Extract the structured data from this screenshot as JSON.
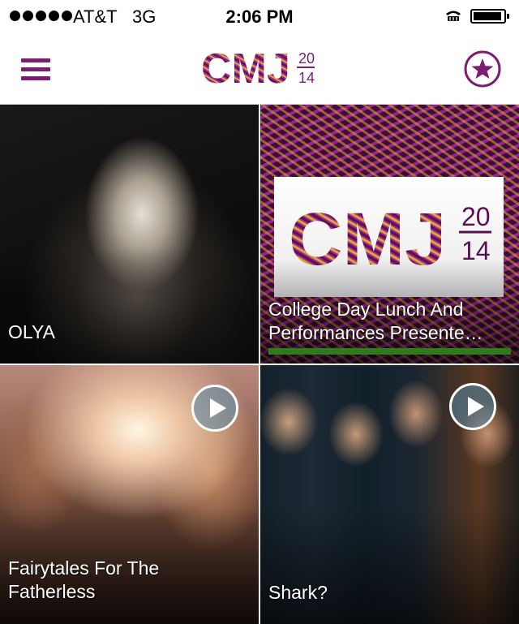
{
  "status_bar": {
    "carrier": "AT&T",
    "network": "3G",
    "time": "2:06 PM",
    "signal_bars": 5,
    "battery_level": 0.85
  },
  "nav": {
    "menu_icon": "hamburger-menu-icon",
    "logo": {
      "letters": "CMJ",
      "year_top": "20",
      "year_bottom": "14"
    },
    "favorites_icon": "star-circle-icon",
    "accent_color": "#7b1d74"
  },
  "tiles": [
    {
      "title_lines": [
        "OLYA"
      ],
      "has_play": false
    },
    {
      "title_lines": [
        "College Day Lunch And",
        "Performances Presente…"
      ],
      "has_play": false,
      "progress": 1.0,
      "progress_color": "#2f7a1d",
      "card_logo": {
        "letters": "CMJ",
        "year_top": "20",
        "year_bottom": "14"
      }
    },
    {
      "title_lines": [
        "Fairytales For The",
        "Fatherless"
      ],
      "has_play": true
    },
    {
      "title_lines": [
        "Shark?"
      ],
      "has_play": true
    }
  ]
}
